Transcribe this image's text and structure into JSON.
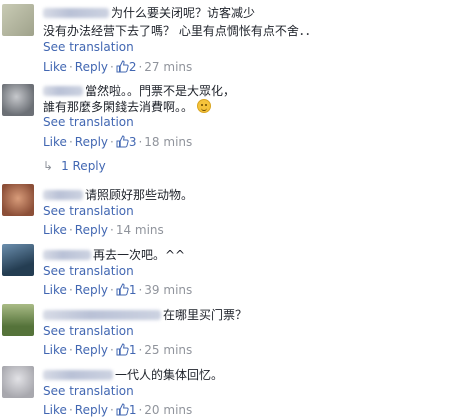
{
  "ui": {
    "see_translation": "See translation",
    "like": "Like",
    "reply": "Reply",
    "dot": "·"
  },
  "comments": [
    {
      "lines": [
        "为什么要关闭呢？访客减少",
        "没有办法经营下去了嗎？ 心里有点惆怅有点不舍．．"
      ],
      "likes": "2",
      "time": "27 mins",
      "avatar_color": "#b8b9a2"
    },
    {
      "lines": [
        "當然啦。。門票不是大眾化，",
        "誰有那麼多閑錢去消費啊。。"
      ],
      "likes": "3",
      "time": "18 mins",
      "replies": "1 Reply",
      "avatar_color": "#8a8d93"
    },
    {
      "lines": [
        "请照顾好那些动物。"
      ],
      "likes": "",
      "time": "14 mins",
      "avatar_color": "#b27357"
    },
    {
      "lines": [
        "再去一次吧。^^"
      ],
      "likes": "1",
      "time": "39 mins",
      "avatar_color": "#3c5a74"
    },
    {
      "lines": [
        "在哪里买门票？"
      ],
      "likes": "1",
      "time": "25 mins",
      "avatar_color": "#7b9a5a"
    },
    {
      "lines": [
        "一代人的集体回忆。"
      ],
      "likes": "1",
      "time": "20 mins",
      "avatar_color": "#c7c7cc"
    }
  ]
}
